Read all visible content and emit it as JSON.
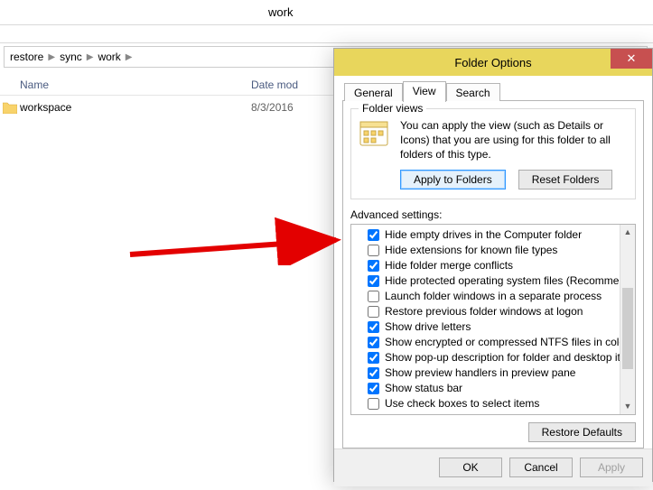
{
  "explorer": {
    "title": "work",
    "breadcrumb": [
      "restore",
      "sync",
      "work"
    ],
    "columns": {
      "name": "Name",
      "date": "Date mod"
    },
    "rows": [
      {
        "name": "workspace",
        "date": "8/3/2016"
      }
    ]
  },
  "dialog": {
    "title": "Folder Options",
    "tabs": {
      "general": "General",
      "view": "View",
      "search": "Search"
    },
    "folder_views": {
      "legend": "Folder views",
      "text": "You can apply the view (such as Details or Icons) that you are using for this folder to all folders of this type.",
      "apply_btn": "Apply to Folders",
      "reset_btn": "Reset Folders"
    },
    "advanced_label": "Advanced settings:",
    "settings": [
      {
        "label": "Hide empty drives in the Computer folder",
        "checked": true
      },
      {
        "label": "Hide extensions for known file types",
        "checked": false
      },
      {
        "label": "Hide folder merge conflicts",
        "checked": true
      },
      {
        "label": "Hide protected operating system files (Recommended)",
        "checked": true
      },
      {
        "label": "Launch folder windows in a separate process",
        "checked": false
      },
      {
        "label": "Restore previous folder windows at logon",
        "checked": false
      },
      {
        "label": "Show drive letters",
        "checked": true
      },
      {
        "label": "Show encrypted or compressed NTFS files in color",
        "checked": true
      },
      {
        "label": "Show pop-up description for folder and desktop items",
        "checked": true
      },
      {
        "label": "Show preview handlers in preview pane",
        "checked": true
      },
      {
        "label": "Show status bar",
        "checked": true
      },
      {
        "label": "Use check boxes to select items",
        "checked": false
      }
    ],
    "restore_defaults": "Restore Defaults",
    "buttons": {
      "ok": "OK",
      "cancel": "Cancel",
      "apply": "Apply"
    }
  }
}
